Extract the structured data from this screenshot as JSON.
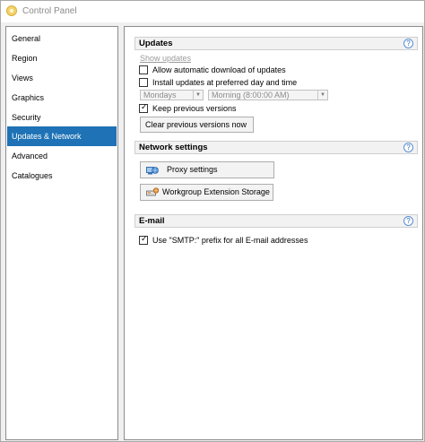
{
  "window": {
    "title": "Control Panel"
  },
  "sidebar": {
    "items": [
      {
        "label": "General"
      },
      {
        "label": "Region"
      },
      {
        "label": "Views"
      },
      {
        "label": "Graphics"
      },
      {
        "label": "Security"
      },
      {
        "label": "Updates & Network",
        "selected": true
      },
      {
        "label": "Advanced"
      },
      {
        "label": "Catalogues"
      }
    ]
  },
  "updates": {
    "title": "Updates",
    "help": "?",
    "show_updates": "Show updates",
    "auto_download": {
      "label": "Allow automatic download of updates",
      "checked": false
    },
    "install_preferred": {
      "label": "Install updates at preferred day and time",
      "checked": false
    },
    "day_select": {
      "value": "Mondays",
      "enabled": false
    },
    "time_select": {
      "value": "Morning (8:00:00 AM)",
      "enabled": false
    },
    "keep_previous": {
      "label": "Keep previous versions",
      "checked": true
    },
    "clear_button": "Clear previous versions now"
  },
  "network": {
    "title": "Network settings",
    "help": "?",
    "proxy_button": "Proxy settings",
    "proxy_icon": "network-globe-icon",
    "workgroup_button": "Workgroup Extension Storage",
    "workgroup_icon": "network-storage-icon"
  },
  "email": {
    "title": "E-mail",
    "help": "?",
    "smtp_prefix": {
      "label": "Use \"SMTP:\" prefix for all E-mail addresses",
      "checked": true
    }
  },
  "colors": {
    "selection": "#1e72b5",
    "section_header_bg": "#f2f2f2",
    "window_bg": "#f0f0f0"
  }
}
